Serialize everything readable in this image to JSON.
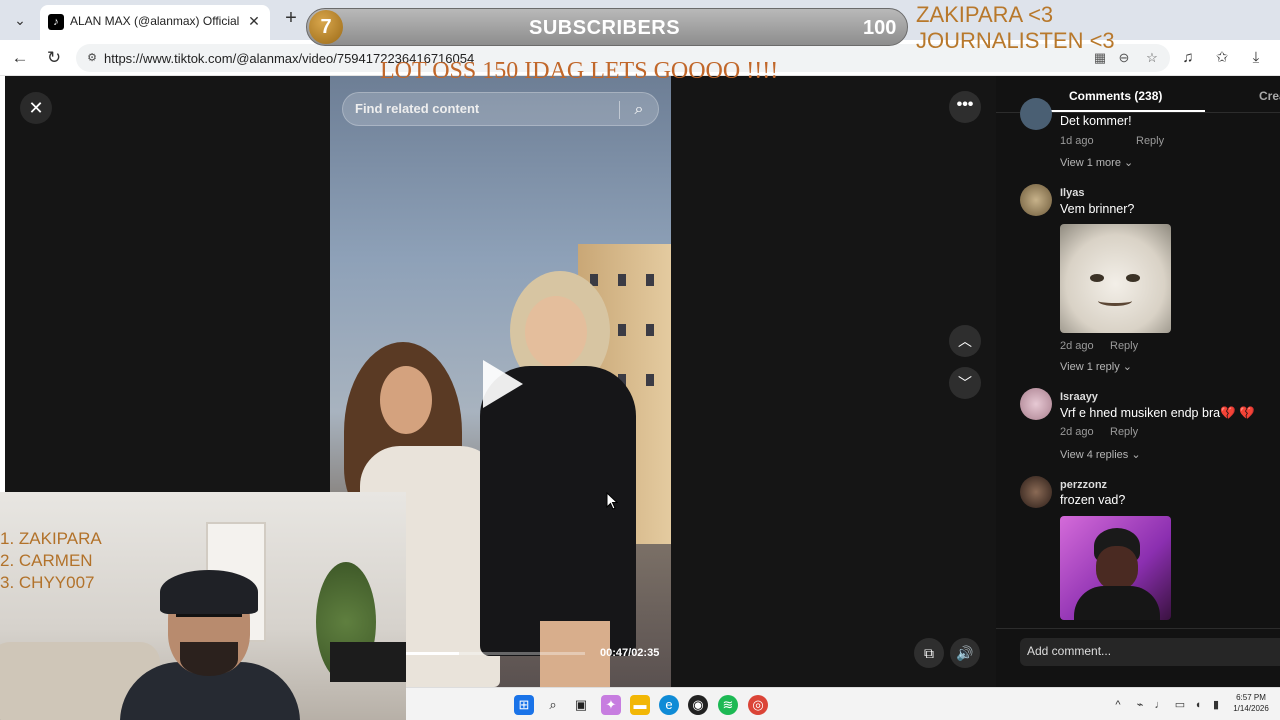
{
  "browser": {
    "tab_title": "ALAN MAX (@alanmax) Official | T",
    "tab_favicon": "tiktok-icon",
    "tab_close": "✕",
    "new_tab": "+",
    "url": "https://www.tiktok.com/@alanmax/video/7594172236416716054",
    "back": "←",
    "reload": "↻"
  },
  "overlay": {
    "sub_count_left": "7",
    "sub_label": "SUBSCRIBERS",
    "sub_count_right": "100",
    "top_names": [
      "ZAKIPARA <3",
      "JOURNALISTEN <3"
    ],
    "banner": "LOT OSS 150 IDAG LETS GOOOO !!!!",
    "leaderboard": [
      "1. ZAKIPARA",
      "2. CARMEN",
      "3. CHYY007"
    ]
  },
  "video": {
    "search_placeholder": "Find related content",
    "time": "00:47/02:35",
    "progress": 0.3
  },
  "comments": {
    "tab_label": "Comments (238)",
    "tab_creator": "Creator videos",
    "items": [
      {
        "user": "",
        "text": "Det kommer!",
        "time": "1d ago",
        "reply": "Reply",
        "view": "View 1 more"
      },
      {
        "user": "Ilyas",
        "text": "Vem brinner?",
        "time": "2d ago",
        "reply": "Reply",
        "view": "View 1 reply"
      },
      {
        "user": "Israayy",
        "text": "Vrf e hned musiken endp bra💔 💔",
        "time": "2d ago",
        "reply": "Reply",
        "view": "View 4 replies"
      },
      {
        "user": "perzzonz",
        "text": "frozen vad?",
        "time": "",
        "reply": "",
        "view": ""
      }
    ],
    "add_placeholder": "Add comment..."
  },
  "taskbar": {
    "clock_time": "6:57 PM",
    "clock_date": "1/14/2026"
  },
  "colors": {
    "accent_overlay": "#b8782b",
    "panel_bg": "#121212"
  }
}
